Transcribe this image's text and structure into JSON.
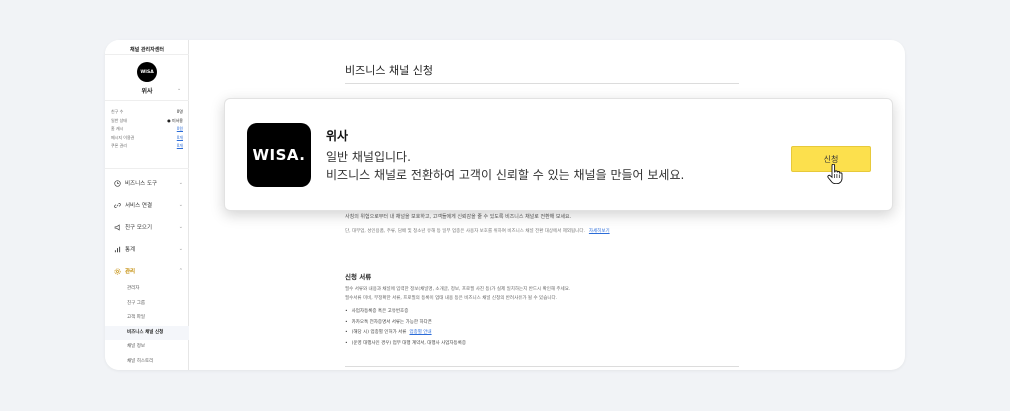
{
  "sidebar": {
    "title": "채널 관리자센터",
    "logo_text": "WISA",
    "channel_name": "위사",
    "stats": [
      {
        "label": "친구 수",
        "value": "0명",
        "link": false
      },
      {
        "label": "일반 상태",
        "value": "● 미서용",
        "link": false
      },
      {
        "label": "홈 캐시",
        "value": "0원",
        "link": true
      },
      {
        "label": "메시지 이용권",
        "value": "0개",
        "link": true
      },
      {
        "label": "쿠폰 권리",
        "value": "0개",
        "link": true
      }
    ],
    "nav": [
      {
        "label": "비즈니스 도구"
      },
      {
        "label": "서비스 연결"
      },
      {
        "label": "친구 모으기"
      },
      {
        "label": "통계"
      },
      {
        "label": "관리"
      }
    ],
    "sub_items": [
      "관리자",
      "친구 그룹",
      "고객 파일",
      "비즈니스 채널 신청",
      "채널 정보",
      "채널 히스토리"
    ]
  },
  "main": {
    "page_title": "비즈니스 채널 신청",
    "desc1": "사칭의 위험으로부터 내 채널을 보호하고, 고객들에게 신뢰감을 줄 수 있도록 비즈니스 채널로 전환해 보세요.",
    "desc2": "단, 대부업, 성인용품, 주류, 담배 및 청소년 유해 등 일부 업종은 사용자 보호를 위하여 비즈니스 채널 전환 대상에서 제외됩니다.",
    "desc2_link": "자세히보기",
    "section_title": "신청 서류",
    "section_desc_1": "필수 서류와 내용과 채널에 입력한 정보(채널명, 소개글, 정보, 프로필 사진 등)가 실제 일치하는지 반드시 확인해 주세요.",
    "section_desc_2": "필수서류 미비, 부정확한 서류, 프로필의 등록이 업태 내용 등은 비즈니스 채널 신청의 반려사유가 될 수 있습니다.",
    "bullets": [
      {
        "text": "사업자등록증 혹은 고유번호증",
        "link": ""
      },
      {
        "text": "카카오톡 전자증명서 서류는 가능한 하다픈",
        "link": ""
      },
      {
        "text": "(해당 시) 업종별 인허가 서류",
        "link": "업종별 안내"
      },
      {
        "text": "(운영 대행사인 경우) 업무 대행 계약서, 대행사 사업자등록증",
        "link": ""
      }
    ]
  },
  "card": {
    "logo_text": "WISA.",
    "name": "위사",
    "line1": "일반 채널입니다.",
    "line2": "비즈니스 채널로 전환하여 고객이 신뢰할 수 있는 채널을 만들어 보세요.",
    "button_label": "신청"
  },
  "colors": {
    "accent_yellow": "#fce04d",
    "link_blue": "#2b6cd8",
    "active_nav": "#c28a00",
    "background": "#f1f3f6"
  },
  "icons": {
    "nav": [
      "clock-icon",
      "link-icon",
      "megaphone-icon",
      "bar-chart-icon",
      "gear-icon"
    ],
    "cursor": "hand-pointer-icon"
  }
}
